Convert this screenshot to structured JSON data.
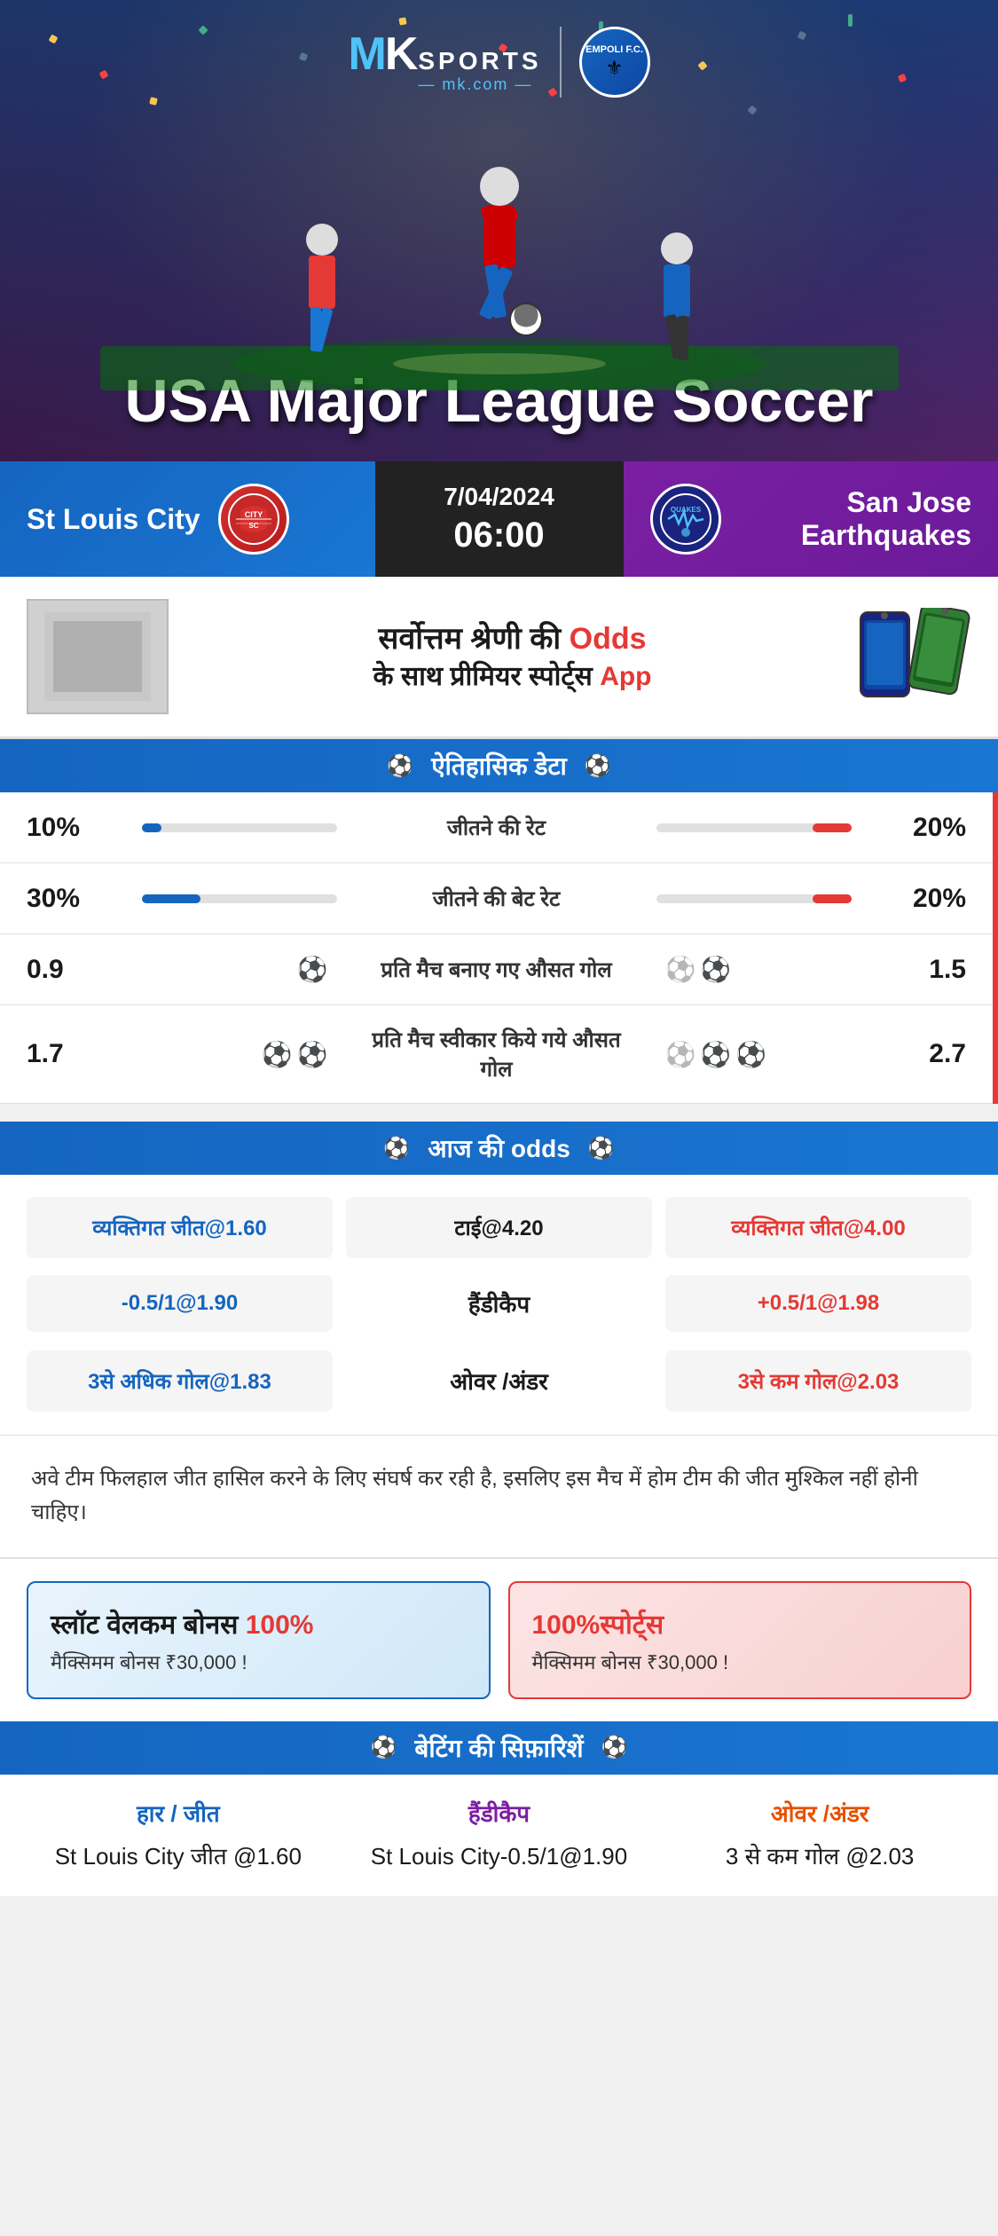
{
  "header": {
    "logo": {
      "mk": "MK",
      "sports": "SPORTS",
      "domain": "mk.com"
    },
    "partner": "EMPOLI F.C.",
    "title": "USA Major League Soccer"
  },
  "match": {
    "team_left": "St Louis City",
    "team_right": "San Jose Earthquakes",
    "date": "7/04/2024",
    "time": "06:00",
    "badge_left": "CITY SC",
    "badge_right": "QUAKES"
  },
  "promo": {
    "text_line1": "सर्वोत्तम श्रेणी की",
    "text_highlight": "Odds",
    "text_line2": "के साथ प्रीमियर स्पोर्ट्स",
    "text_app": "App"
  },
  "historical": {
    "section_title": "ऐतिहासिक डेटा",
    "rows": [
      {
        "label": "जीतने की रेट",
        "left_val": "10%",
        "right_val": "20%",
        "left_bar": 10,
        "right_bar": 20
      },
      {
        "label": "जीतने की बेट रेट",
        "left_val": "30%",
        "right_val": "20%",
        "left_bar": 30,
        "right_bar": 20
      },
      {
        "label": "प्रति मैच बनाए गए औसत गोल",
        "left_val": "0.9",
        "right_val": "1.5",
        "left_balls": 1,
        "right_balls": 2
      },
      {
        "label": "प्रति मैच स्वीकार किये गये औसत गोल",
        "left_val": "1.7",
        "right_val": "2.7",
        "left_balls": 2,
        "right_balls": 3
      }
    ]
  },
  "odds": {
    "section_title": "आज की odds",
    "rows": [
      {
        "left": "व्यक्तिगत जीत@1.60",
        "center": "टाई@4.20",
        "right": "व्यक्तिगत जीत@4.00",
        "center_label": ""
      },
      {
        "left": "-0.5/1@1.90",
        "center": "हैंडीकैप",
        "right": "+0.5/1@1.98",
        "center_label": "हैंडीकैप"
      },
      {
        "left": "3से अधिक गोल@1.83",
        "center": "ओवर /अंडर",
        "right": "3से कम गोल@2.03",
        "center_label": "ओवर /अंडर"
      }
    ]
  },
  "analysis": {
    "text": "अवे टीम फिलहाल जीत हासिल करने के लिए संघर्ष कर रही है, इसलिए इस मैच में होम टीम की जीत मुश्किल नहीं होनी चाहिए।"
  },
  "bonus": {
    "left_title": "स्लॉट वेलकम बोनस 100%",
    "left_sub": "मैक्सिमम बोनस ₹30,000  !",
    "right_title": "100%स्पोर्ट्स",
    "right_sub": "मैक्सिमम बोनस  ₹30,000 !"
  },
  "betting": {
    "section_title": "बेटिंग की सिफ़ारिशें",
    "cols": [
      {
        "type": "हार / जीत",
        "value": "St Louis City जीत @1.60",
        "color": "blue"
      },
      {
        "type": "हैंडीकैप",
        "value": "St Louis City-0.5/1@1.90",
        "color": "purple"
      },
      {
        "type": "ओवर /अंडर",
        "value": "3 से कम गोल @2.03",
        "color": "orange"
      }
    ]
  }
}
